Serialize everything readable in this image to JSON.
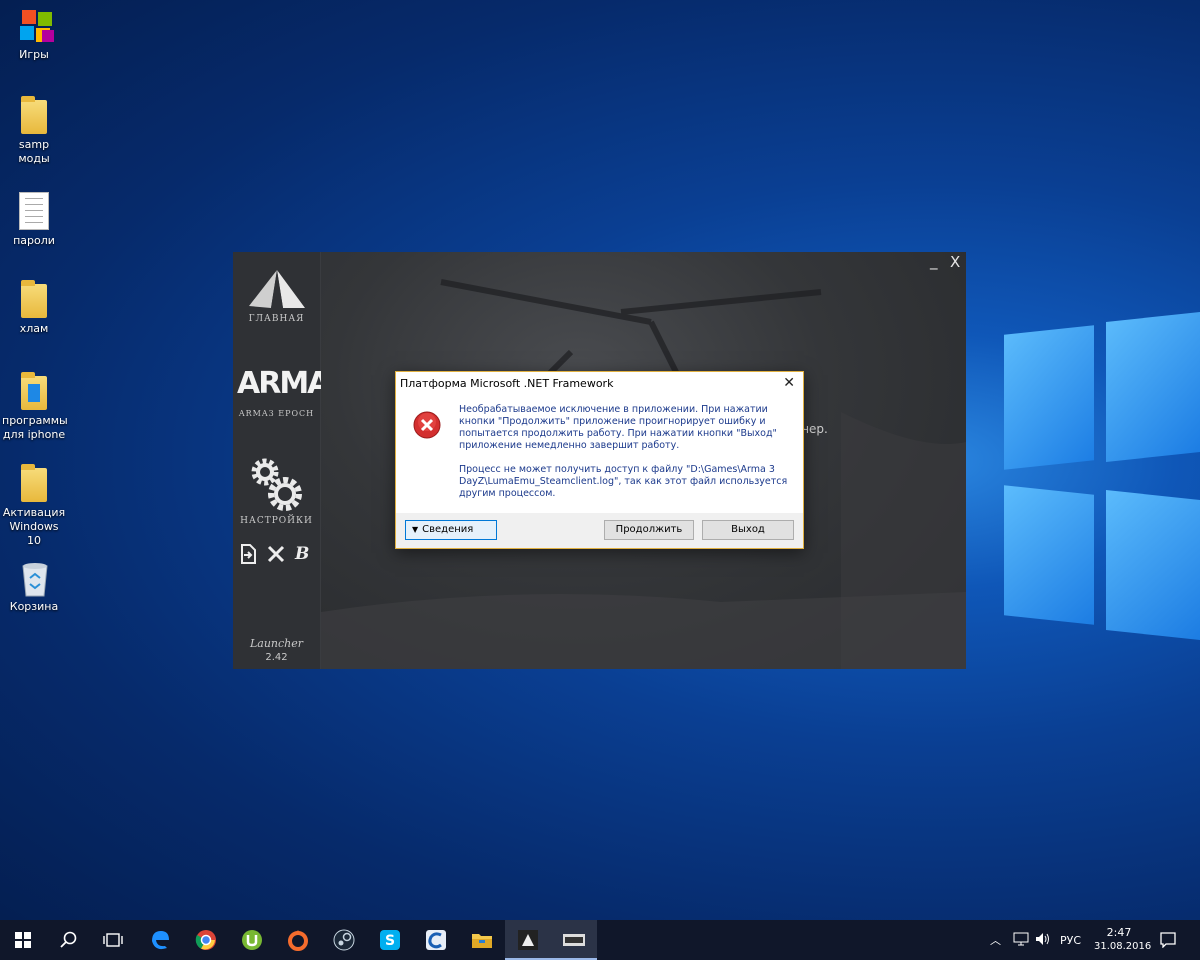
{
  "desktop": {
    "icons": [
      {
        "label": "Игры"
      },
      {
        "label": "samp моды"
      },
      {
        "label": "пароли"
      },
      {
        "label": "хлам"
      },
      {
        "label": "программы для iphone"
      },
      {
        "label": "Активация Windows 10"
      },
      {
        "label": "Корзина"
      }
    ]
  },
  "launcher": {
    "nav": {
      "home": "ГЛАВНАЯ",
      "arma": "ARMA",
      "epoch": "ARMA3 EPOCH",
      "settings": "НАСТРОЙКИ"
    },
    "version_label": "Launcher",
    "version": "2.42",
    "minimize": "_",
    "close": "X",
    "bg_text": "унчер."
  },
  "dialog": {
    "title": "Платформа Microsoft .NET Framework",
    "message1": "Необрабатываемое исключение в приложении. При нажатии кнопки \"Продолжить\" приложение проигнорирует ошибку и попытается продолжить работу. При нажатии кнопки \"Выход\" приложение немедленно завершит работу.",
    "message2": "Процесс не может получить доступ к файлу \"D:\\Games\\Arma 3 DayZ\\LumaEmu_Steamclient.log\", так как этот файл используется другим процессом.",
    "details_button": "Сведения",
    "continue_button": "Продолжить",
    "exit_button": "Выход"
  },
  "taskbar": {
    "language": "РУС",
    "time": "2:47",
    "date": "31.08.2016"
  },
  "colors": {
    "accent": "#0a3f93",
    "dialog_text": "#1c3a8c",
    "taskbar": "#10172a"
  }
}
